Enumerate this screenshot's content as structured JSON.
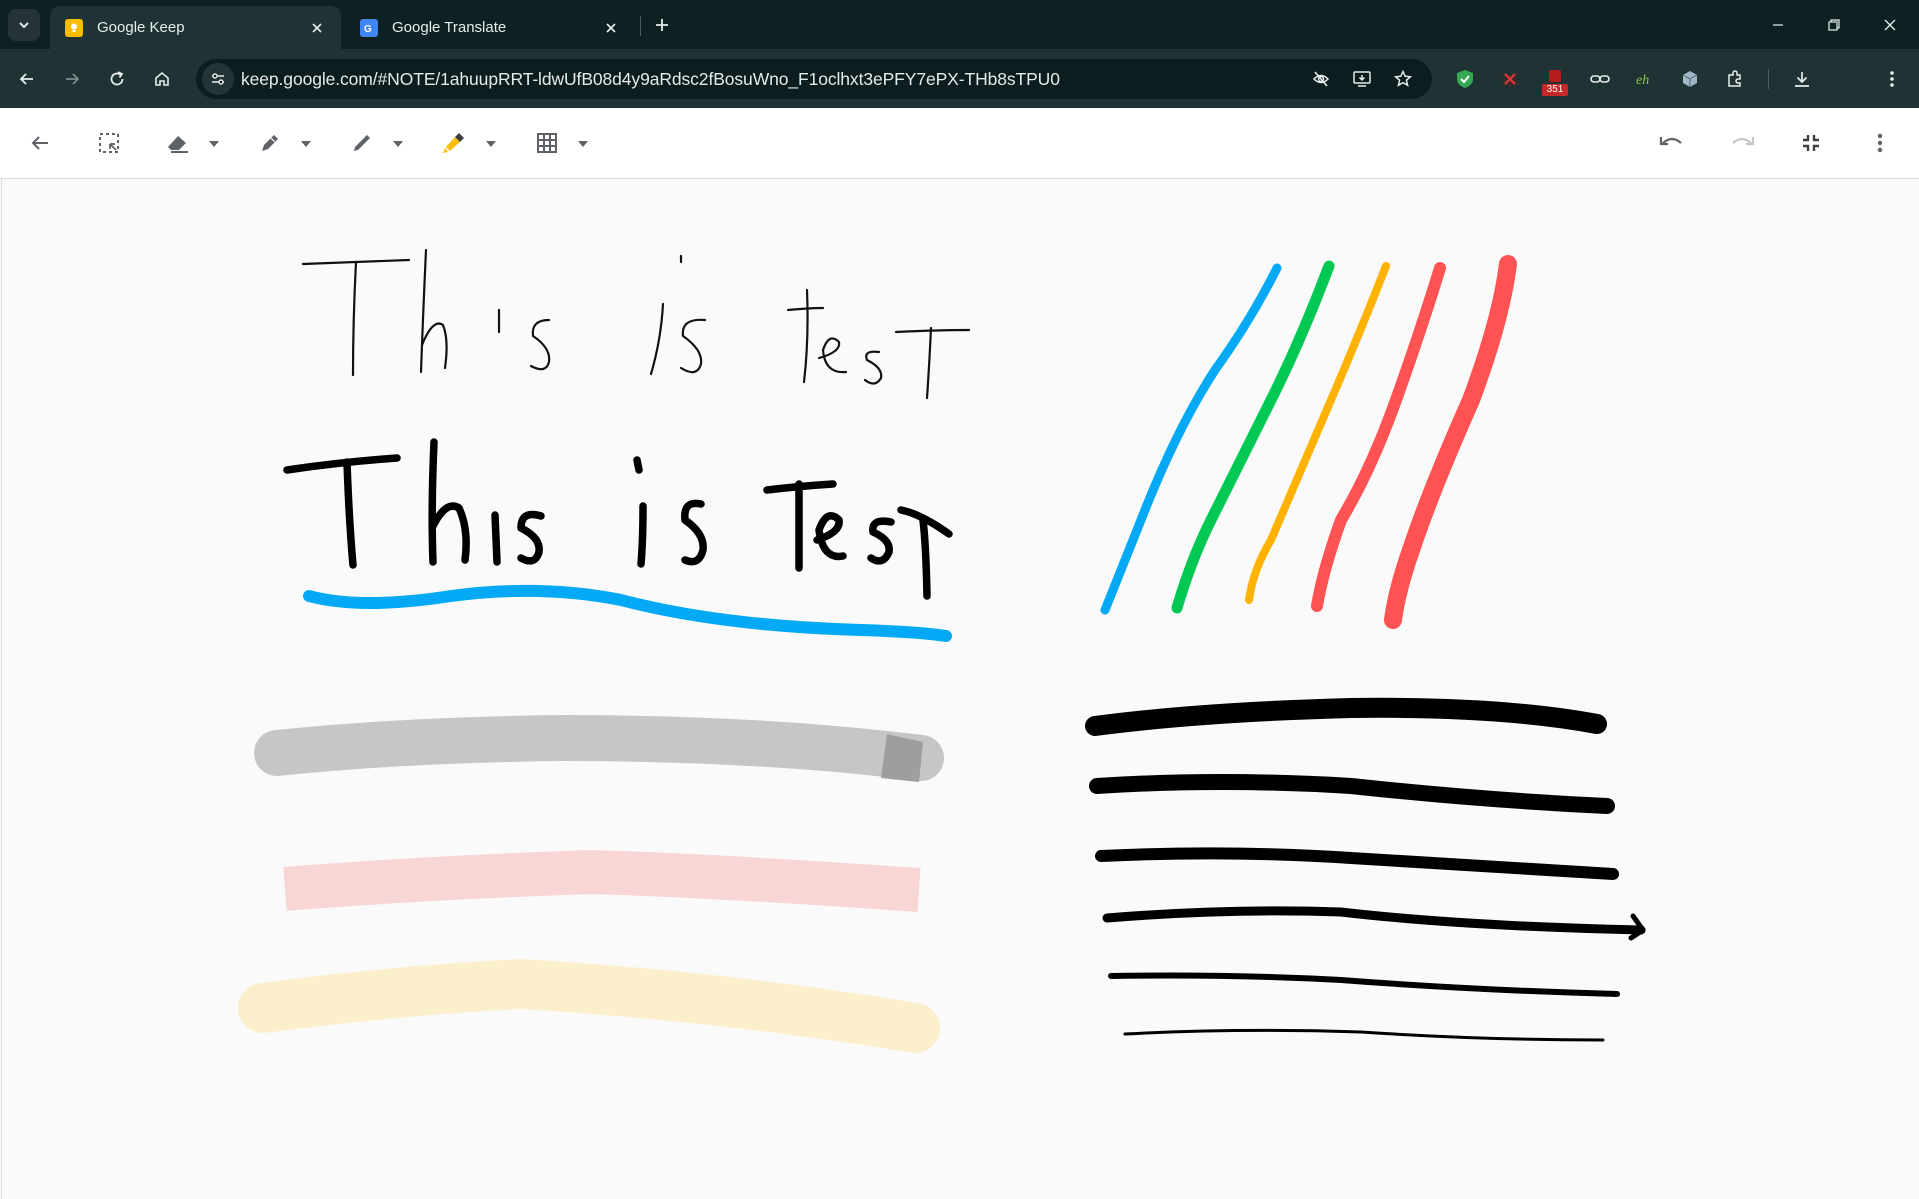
{
  "browser": {
    "tabs": [
      {
        "title": "Google Keep",
        "favicon": "keep-icon",
        "active": true
      },
      {
        "title": "Google Translate",
        "favicon": "translate-icon",
        "active": false
      }
    ],
    "url": "keep.google.com/#NOTE/1ahuupRRT-ldwUfB08d4y9aRdsc2fBosuWno_F1oclhxt3ePFY7ePX-THb8sTPU0",
    "extension_badge": "351"
  },
  "drawing_toolbar": {
    "tools": [
      "back-icon",
      "select-icon",
      "eraser-icon",
      "pen-icon",
      "marker-icon",
      "highlighter-icon",
      "grid-icon"
    ],
    "highlighter_color": "#fbbc04"
  },
  "canvas": {
    "handwriting": [
      "This is test",
      "This is test"
    ],
    "stroke_colors": [
      "#03a9f4",
      "#00c853",
      "#ffb300",
      "#ff5252",
      "#ff5252"
    ],
    "highlight_colors": [
      "#c6c6c6",
      "#f9d6d6",
      "#fcefcc"
    ],
    "underline_color": "#03a9f4"
  }
}
